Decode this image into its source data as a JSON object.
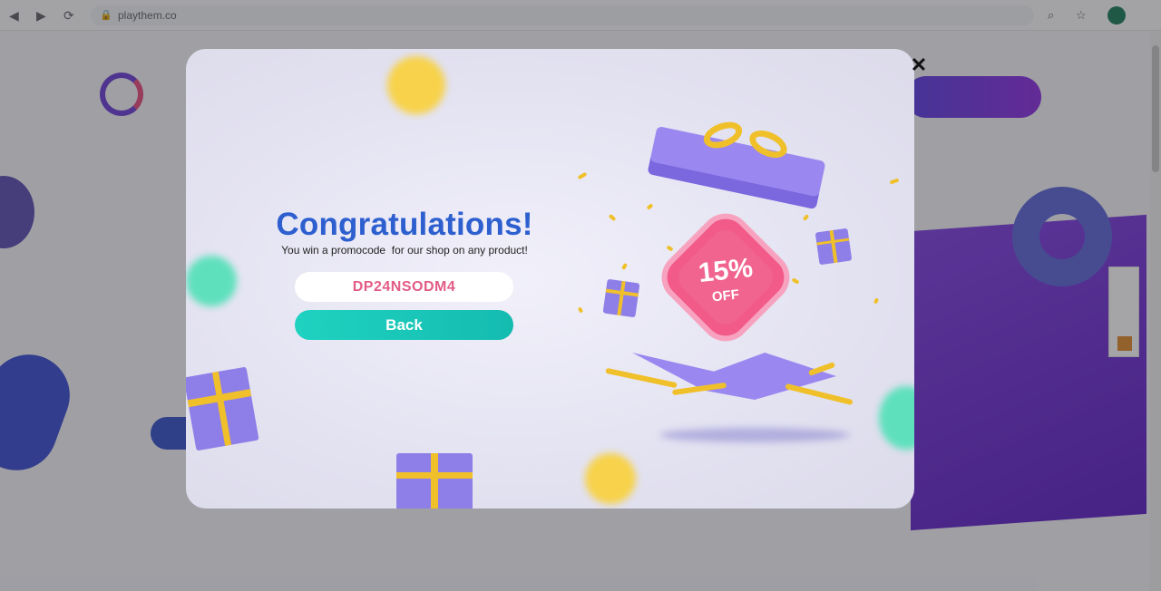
{
  "browser": {
    "url": "playthem.co",
    "back_icon": "back-arrow-icon",
    "forward_icon": "forward-arrow-icon",
    "reload_icon": "reload-icon"
  },
  "modal": {
    "title": "Congratulations!",
    "subtitle": "You win a promocode  for our shop on any product!",
    "promo_code": "DP24NSODM4",
    "back_label": "Back",
    "close_label": "✕",
    "badge_percent": "15%",
    "badge_off": "OFF"
  },
  "colors": {
    "title": "#2d5fcf",
    "code": "#e25c86",
    "back_button": "#1fd2c0",
    "badge": "#f25a8a",
    "gift": "#9a88f0",
    "ribbon": "#f0c02a"
  }
}
